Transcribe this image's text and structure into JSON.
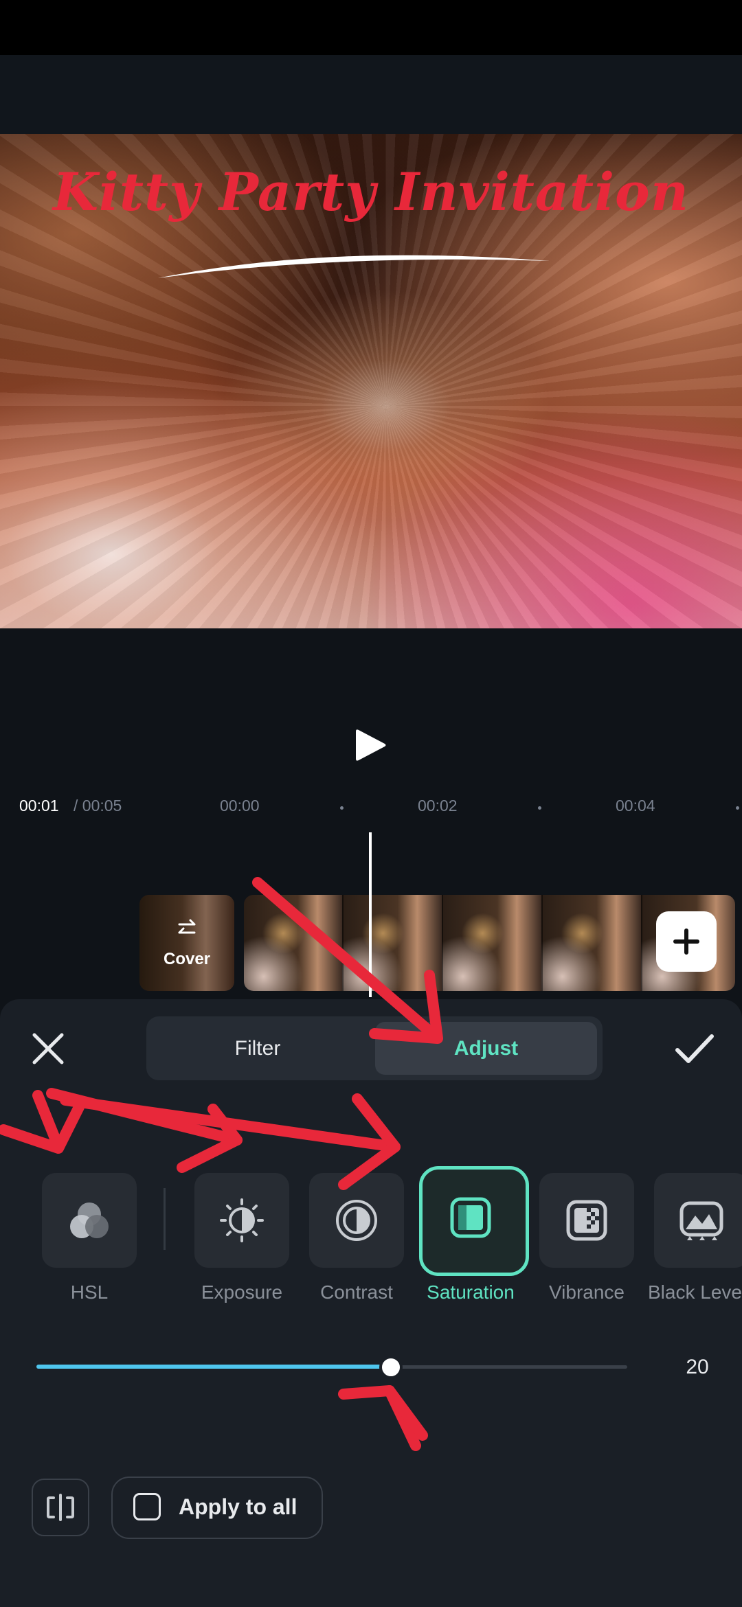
{
  "preview": {
    "title": "Kitty Party Invitation"
  },
  "timeline": {
    "current_time": "00:01",
    "total_time": "/ 00:05",
    "ticks": [
      "00:00",
      "00:02",
      "00:04"
    ],
    "cover_label": "Cover"
  },
  "tabs": {
    "filter": "Filter",
    "adjust": "Adjust",
    "selected": "Adjust"
  },
  "tools": {
    "hsl": "HSL",
    "exposure": "Exposure",
    "contrast": "Contrast",
    "saturation": "Saturation",
    "vibrance": "Vibrance",
    "black_level": "Black Level",
    "selected": "Saturation"
  },
  "slider": {
    "value": "20",
    "fraction": 0.6
  },
  "apply_to_all": {
    "label": "Apply to all",
    "checked": false
  },
  "colors": {
    "accent": "#5fe3c2",
    "slider": "#4fc6ee",
    "annotation": "#e8283a"
  }
}
